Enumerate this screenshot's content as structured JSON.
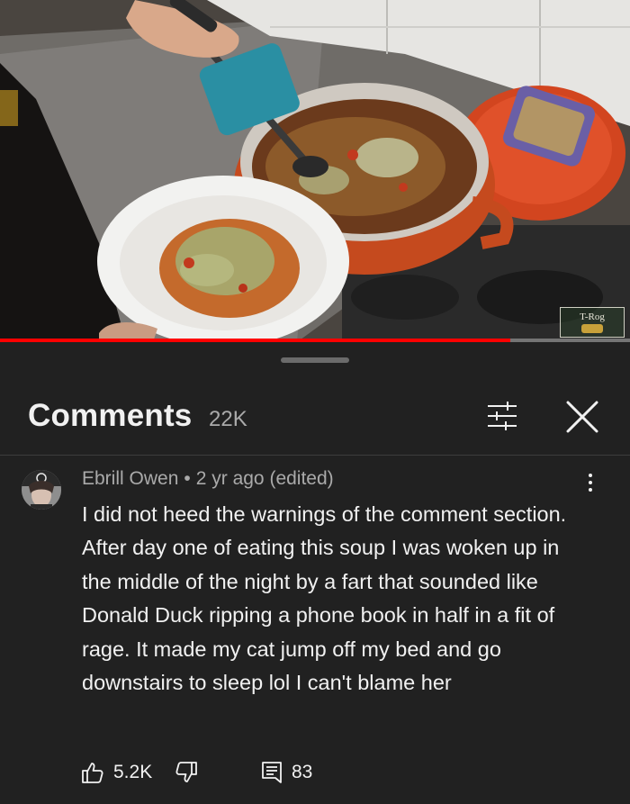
{
  "video": {
    "progress_fraction": 0.81,
    "watermark_text": "T-Rog"
  },
  "comments_panel": {
    "title": "Comments",
    "count": "22K"
  },
  "comment": {
    "author": "Ebrill Owen",
    "separator": "•",
    "time": "2 yr ago (edited)",
    "text": "I did not heed the warnings of the comment section. After day one of eating this soup I was woken up in the middle of the night by a fart that sounded like Donald Duck ripping a phone book in half in a fit of rage. It made my cat jump off my bed and go downstairs to sleep lol I can't blame her",
    "likes": "5.2K",
    "replies": "83"
  },
  "icons": {
    "filter": "sliders-icon",
    "close": "close-icon",
    "more": "more-vertical-icon",
    "like": "thumbs-up-icon",
    "dislike": "thumbs-down-icon",
    "replies": "comment-icon"
  },
  "colors": {
    "background": "#212121",
    "progress": "#ff0000",
    "secondary_text": "#aaaaaa",
    "primary_text": "#f1f1f1"
  }
}
